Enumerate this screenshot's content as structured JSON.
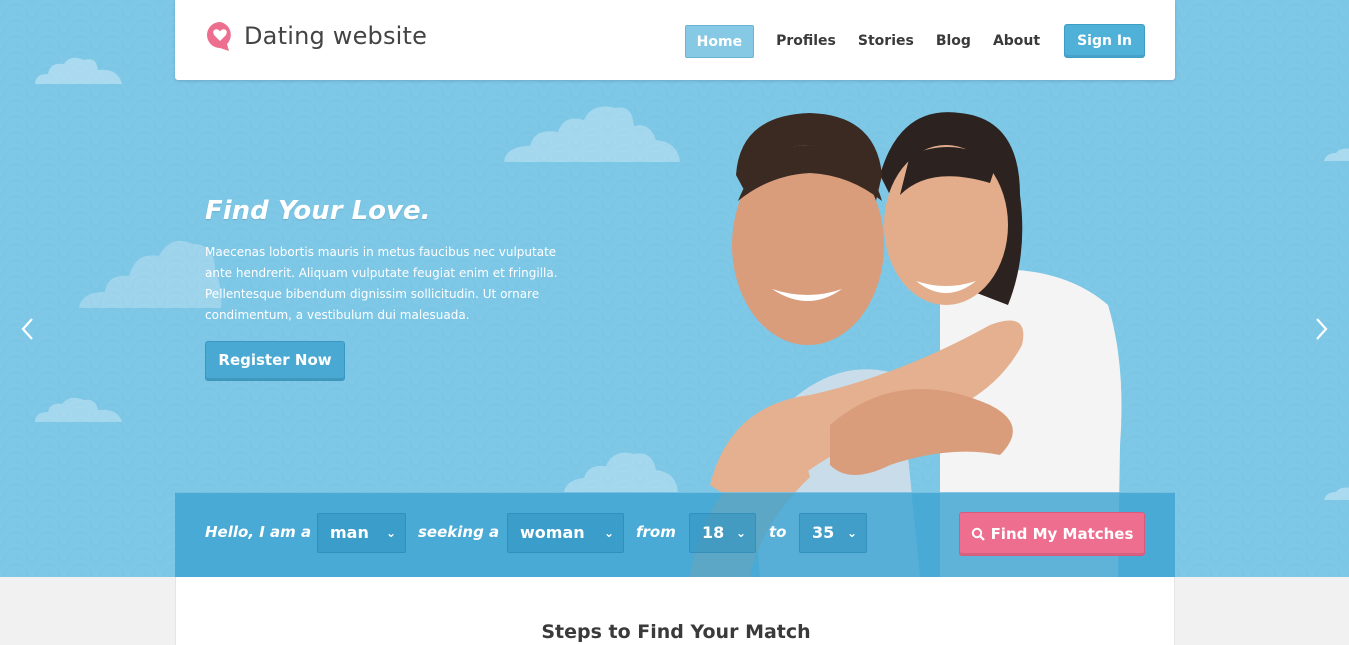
{
  "brand": {
    "name": "Dating website",
    "accent": "#4fb0d8",
    "pink": "#ee6e8f",
    "sky": "#7cc6e6"
  },
  "nav": {
    "items": [
      {
        "label": "Home",
        "active": true
      },
      {
        "label": "Profiles"
      },
      {
        "label": "Stories"
      },
      {
        "label": "Blog"
      },
      {
        "label": "About"
      }
    ],
    "signin_label": "Sign In"
  },
  "hero": {
    "title": "Find Your Love.",
    "body": "Maecenas lobortis mauris in metus faucibus nec vulputate ante hendrerit. Aliquam vulputate feugiat enim et fringilla. Pellentesque bibendum dignissim sollicitudin. Ut ornare condimentum, a vestibulum dui malesuada.",
    "register_label": "Register Now",
    "prev_icon": "chevron-left-icon",
    "next_icon": "chevron-right-icon"
  },
  "search": {
    "label_iam": "Hello, I am a",
    "gender": "man",
    "label_seeking": "seeking a",
    "seeking": "woman",
    "label_from": "from",
    "age_from": "18",
    "label_to": "to",
    "age_to": "35",
    "button_label": "Find My Matches"
  },
  "steps": {
    "title": "Steps to Find Your Match"
  }
}
